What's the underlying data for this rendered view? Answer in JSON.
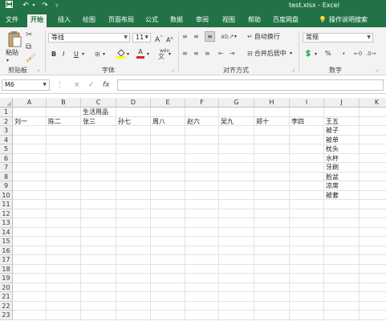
{
  "window": {
    "title": "test.xlsx - Excel"
  },
  "quick_access": {
    "save_icon": "save-icon",
    "undo_icon": "undo-icon",
    "redo_icon": "redo-icon",
    "customize_icon": "customize-icon"
  },
  "tabs": [
    {
      "label": "文件"
    },
    {
      "label": "开始"
    },
    {
      "label": "插入"
    },
    {
      "label": "绘图"
    },
    {
      "label": "页面布局"
    },
    {
      "label": "公式"
    },
    {
      "label": "数据"
    },
    {
      "label": "审阅"
    },
    {
      "label": "视图"
    },
    {
      "label": "帮助"
    },
    {
      "label": "百度网盘"
    }
  ],
  "tell_me": "操作说明搜索",
  "ribbon": {
    "clipboard": {
      "paste_label": "粘贴",
      "group_label": "剪贴板"
    },
    "font": {
      "font_name": "等线",
      "font_size": "11",
      "grow": "A",
      "shrink": "A",
      "bold": "B",
      "italic": "I",
      "underline": "U",
      "font_color_glyph": "A",
      "wen": "wén",
      "group_label": "字体"
    },
    "alignment": {
      "wrap_text": "自动换行",
      "merge_center": "合并后居中",
      "group_label": "对齐方式"
    },
    "number": {
      "format": "常规",
      "percent": "%",
      "comma": ",",
      "group_label": "数字"
    }
  },
  "formula_bar": {
    "name_box": "M6",
    "cancel": "×",
    "enter": "✓",
    "fx": "fx",
    "formula": ""
  },
  "sheet": {
    "columns": [
      "A",
      "B",
      "C",
      "D",
      "E",
      "F",
      "G",
      "H",
      "I",
      "J",
      "K"
    ],
    "rows": [
      "1",
      "2",
      "3",
      "4",
      "5",
      "6",
      "7",
      "8",
      "9",
      "10",
      "11",
      "12",
      "13",
      "14",
      "15",
      "16",
      "17",
      "18",
      "19",
      "20",
      "21",
      "22",
      "23"
    ],
    "row1": {
      "C": "生活用品"
    },
    "row2": {
      "A": "刘一",
      "B": "陈二",
      "C": "张三",
      "D": "孙七",
      "E": "周八",
      "F": "赵六",
      "G": "吴九",
      "H": "郑十",
      "I": "李四",
      "J": "王五"
    },
    "colJ": [
      "被子",
      "被单",
      "枕头",
      "水杯",
      "牙刷",
      "脸盆",
      "凉席",
      "被套"
    ]
  }
}
